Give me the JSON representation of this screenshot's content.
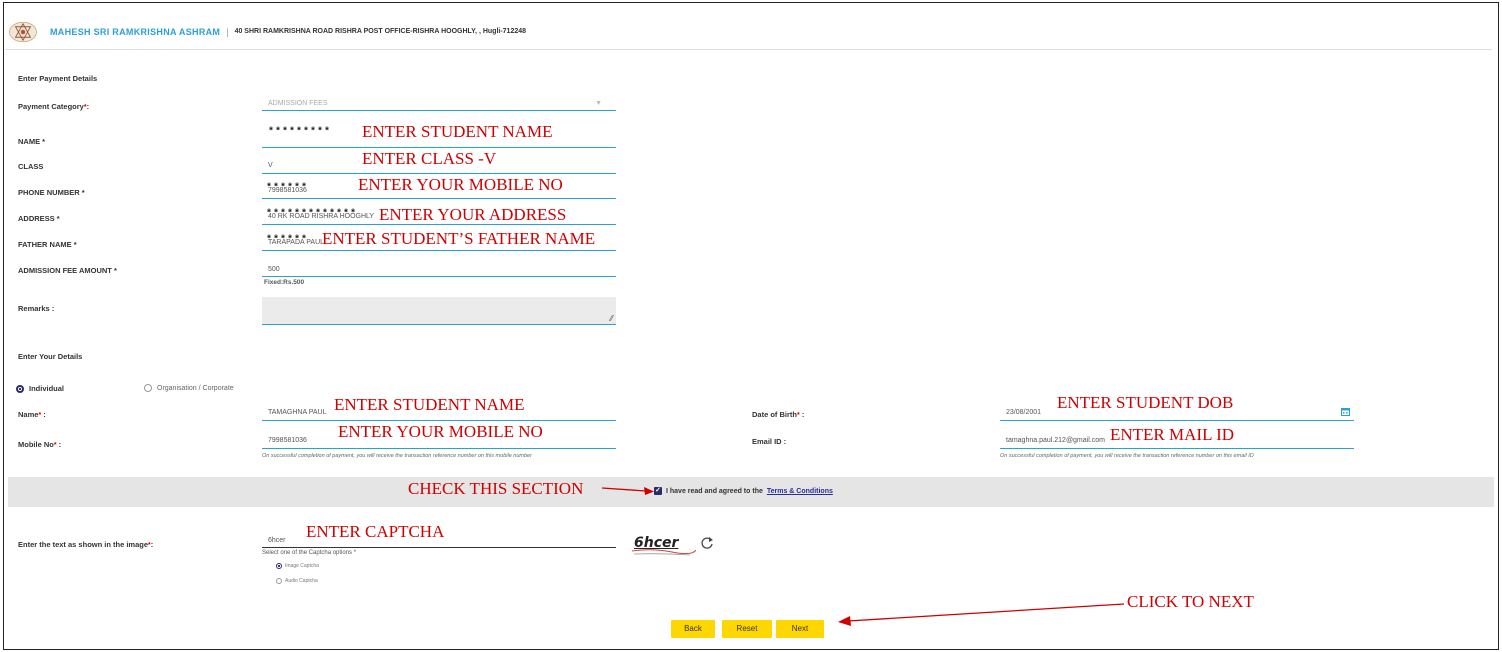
{
  "header": {
    "org_name": "MAHESH SRI RAMKRISHNA ASHRAM",
    "separator": "|",
    "address": "40 SHRI RAMKRISHNA ROAD RISHRA POST OFFICE-RISHRA HOOGHLY, , Hugli-712248"
  },
  "payment": {
    "section_title": "Enter Payment Details",
    "category_label": "Payment Category",
    "category_value": "ADMISSION FEES",
    "name_label": "NAME *",
    "name_value": "*********",
    "class_label": "CLASS",
    "class_value": "V",
    "phone_label": "PHONE NUMBER *",
    "phone_value": "7998581036",
    "phone_mask": "******",
    "address_label": "ADDRESS *",
    "address_value": "40 RK ROAD RISHRA HOOGHLY",
    "address_mask": "*************",
    "father_label": "FATHER NAME *",
    "father_value": "TARAPADA PAUL",
    "father_mask": "******",
    "fee_label": "ADMISSION FEE AMOUNT *",
    "fee_value": "500",
    "fee_fixed": "Fixed:Rs.500",
    "remarks_label": "Remarks :"
  },
  "details": {
    "section_title": "Enter Your Details",
    "individual_label": "Individual",
    "organisation_label": "Organisation / Corporate",
    "name_label": "Name",
    "name_value": "TAMAGHNA PAUL",
    "mobile_label": "Mobile No",
    "mobile_value": "7998581036",
    "mobile_hint": "On successful completion of payment, you will receive the transaction reference number on this mobile number",
    "dob_label": "Date of Birth",
    "dob_value": "23/08/2001",
    "email_label": "Email ID :",
    "email_value": "tamaghna.paul.212@gmail.com",
    "email_hint": "On successful completion of payment, you will receive the transaction reference number on this email ID"
  },
  "terms": {
    "text": "I have read and agreed to the",
    "link": "Terms & Conditions"
  },
  "captcha": {
    "label": "Enter the text as shown in the image",
    "value": "6hcer",
    "select_text": "Select one of the Captcha options *",
    "image_option": "Image Captcha",
    "audio_option": "Audio Captcha",
    "captcha_image_text": "6hcer"
  },
  "buttons": {
    "back": "Back",
    "reset": "Reset",
    "next": "Next"
  },
  "annotations": {
    "student_name": "ENTER STUDENT NAME",
    "class": "ENTER CLASS -V",
    "mobile": "ENTER YOUR MOBILE NO",
    "address": "ENTER YOUR ADDRESS",
    "father": "ENTER STUDENT’S FATHER NAME",
    "student_name2": "ENTER STUDENT NAME",
    "mobile2": "ENTER YOUR MOBILE NO",
    "dob": "ENTER STUDENT DOB",
    "mail": "ENTER MAIL ID",
    "check": "CHECK THIS SECTION",
    "captcha": "ENTER CAPTCHA",
    "next": "CLICK TO NEXT"
  },
  "colors": {
    "accent": "#2aa0d8",
    "annotation": "#d00000",
    "button": "#ffd700"
  }
}
